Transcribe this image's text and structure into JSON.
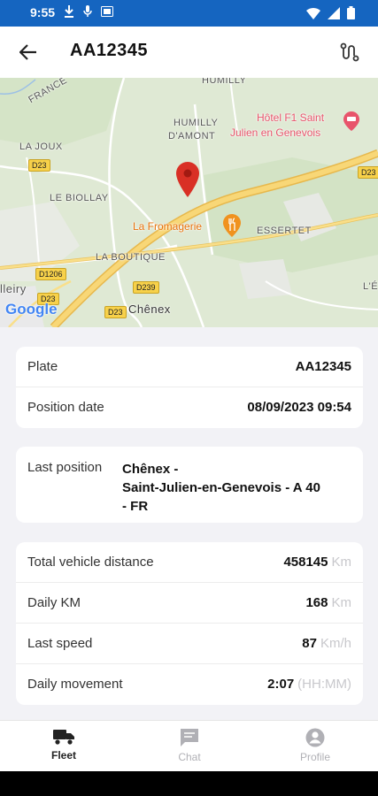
{
  "status_bar": {
    "time": "9:55"
  },
  "header": {
    "title": "AA12345"
  },
  "map": {
    "attribution": "Google",
    "labels": {
      "france": "FRANCE",
      "humilly": "HUMILLY",
      "humilly_damont_1": "HUMILLY",
      "humilly_damont_2": "D'AMONT",
      "la_joux": "LA JOUX",
      "le_biollay": "LE BIOLLAY",
      "essertet": "ESSERTET",
      "la_boutique": "LA BOUTIQUE",
      "chenex": "Chênex",
      "lleiry": "lleiry",
      "edge_e": "L'É"
    },
    "pois": {
      "hotel_1": "Hôtel F1 Saint",
      "hotel_2": "Julien en Genevois",
      "fromagerie": "La Fromagerie"
    },
    "roads": {
      "d23_a": "D23",
      "d23_b": "D23",
      "d23_c": "D23",
      "d23_d": "D23",
      "d1206": "D1206",
      "d239": "D239"
    }
  },
  "vehicle_card": {
    "rows": [
      {
        "label": "Plate",
        "value": "AA12345"
      },
      {
        "label": "Position date",
        "value": "08/09/2023 09:54"
      }
    ]
  },
  "position_card": {
    "label": "Last position",
    "value_line1": "Chênex -",
    "value_line2": "Saint-Julien-en-Genevois - A 40",
    "value_line3": "- FR"
  },
  "stats_card": {
    "rows": [
      {
        "label": "Total vehicle distance",
        "value": "458145",
        "unit": "Km"
      },
      {
        "label": "Daily KM",
        "value": "168",
        "unit": "Km"
      },
      {
        "label": "Last speed",
        "value": "87",
        "unit": "Km/h"
      },
      {
        "label": "Daily movement",
        "value": "2:07",
        "unit": "(HH:MM)"
      }
    ]
  },
  "bottom_nav": {
    "items": [
      {
        "label": "Fleet",
        "icon": "truck-icon",
        "active": true
      },
      {
        "label": "Chat",
        "icon": "chat-icon",
        "active": false
      },
      {
        "label": "Profile",
        "icon": "profile-icon",
        "active": false
      }
    ]
  },
  "colors": {
    "status_bar": "#1565c0",
    "highway": "#f4c95d",
    "marker": "#d93025",
    "poi": "#e8710a",
    "hotel_poi": "#e8546b",
    "inactive_nav": "#b0b0b5"
  }
}
